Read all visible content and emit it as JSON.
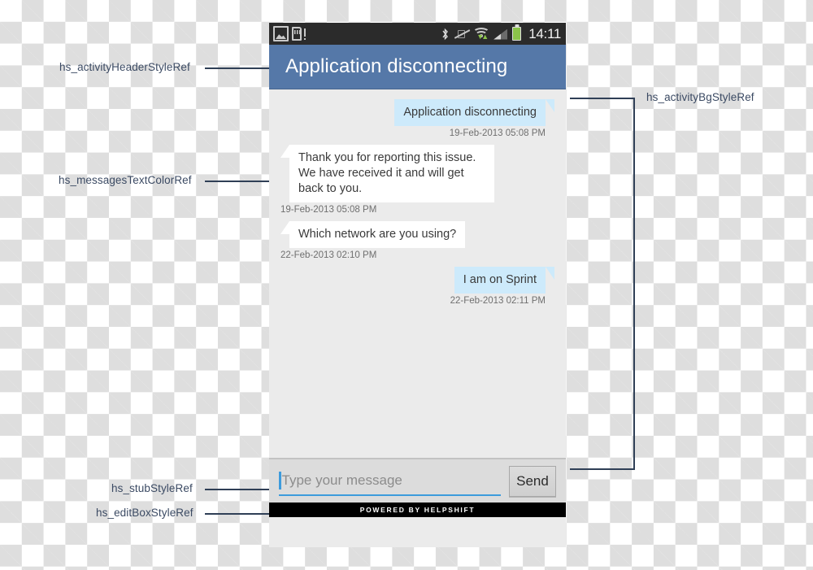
{
  "annotations": [
    {
      "id": "header",
      "label": "hs_activityHeaderStyleRef"
    },
    {
      "id": "messages",
      "label": "hs_messagesTextColorRef"
    },
    {
      "id": "stub",
      "label": "hs_stubStyleRef"
    },
    {
      "id": "editbox",
      "label": "hs_editBoxStyleRef"
    },
    {
      "id": "bg",
      "label": "hs_activityBgStyleRef"
    }
  ],
  "statusbar": {
    "clock": "14:11",
    "notification_icons": [
      "gallery-icon",
      "sd-card-warning-icon"
    ],
    "system_icons": [
      "bluetooth-icon",
      "vibrate-muted-icon",
      "wifi-icon",
      "signal-icon",
      "battery-icon"
    ]
  },
  "header": {
    "title": "Application disconnecting",
    "background_color": "#5578a8",
    "text_color": "#ffffff"
  },
  "conversation": {
    "background_color": "#ebebeb",
    "messages": [
      {
        "direction": "out",
        "text": "Application disconnecting",
        "timestamp": "19-Feb-2013 05:08 PM",
        "bubble_color": "#cdeafb"
      },
      {
        "direction": "in",
        "text": "Thank you for reporting this issue. We have received it and will get back to you.",
        "timestamp": "19-Feb-2013 05:08 PM",
        "bubble_color": "#ffffff"
      },
      {
        "direction": "in",
        "text": "Which network are you using?",
        "timestamp": "22-Feb-2013 02:10 PM",
        "bubble_color": "#ffffff"
      },
      {
        "direction": "out",
        "text": "I am on Sprint",
        "timestamp": "22-Feb-2013 02:11 PM",
        "bubble_color": "#cdeafb"
      }
    ]
  },
  "input": {
    "placeholder": "Type your message",
    "value": "",
    "send_label": "Send",
    "accent_color": "#3d9bdc"
  },
  "footer": {
    "text": "POWERED BY HELPSHIFT"
  }
}
